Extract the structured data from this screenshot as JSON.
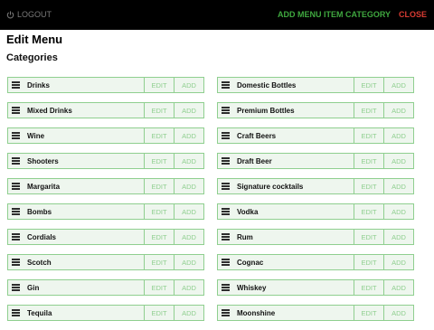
{
  "topbar": {
    "logout_label": "LOGOUT",
    "add_category_label": "ADD MENU ITEM CATEGORY",
    "close_label": "CLOSE"
  },
  "page": {
    "title": "Edit Menu",
    "subtitle": "Categories"
  },
  "buttons": {
    "edit": "EDIT",
    "add": "ADD"
  },
  "colors": {
    "accent_green": "#3fa83f",
    "close_red": "#d83b32",
    "row_border": "#8fcf8f"
  },
  "categories_left": [
    {
      "name": "Drinks"
    },
    {
      "name": "Mixed Drinks"
    },
    {
      "name": "Wine"
    },
    {
      "name": "Shooters"
    },
    {
      "name": "Margarita"
    },
    {
      "name": "Bombs"
    },
    {
      "name": "Cordials"
    },
    {
      "name": "Scotch"
    },
    {
      "name": "Gin"
    },
    {
      "name": "Tequila"
    }
  ],
  "categories_right": [
    {
      "name": "Domestic Bottles"
    },
    {
      "name": "Premium Bottles"
    },
    {
      "name": "Craft Beers"
    },
    {
      "name": "Draft Beer"
    },
    {
      "name": "Signature cocktails"
    },
    {
      "name": "Vodka"
    },
    {
      "name": "Rum"
    },
    {
      "name": "Cognac"
    },
    {
      "name": "Whiskey"
    },
    {
      "name": "Moonshine"
    }
  ]
}
